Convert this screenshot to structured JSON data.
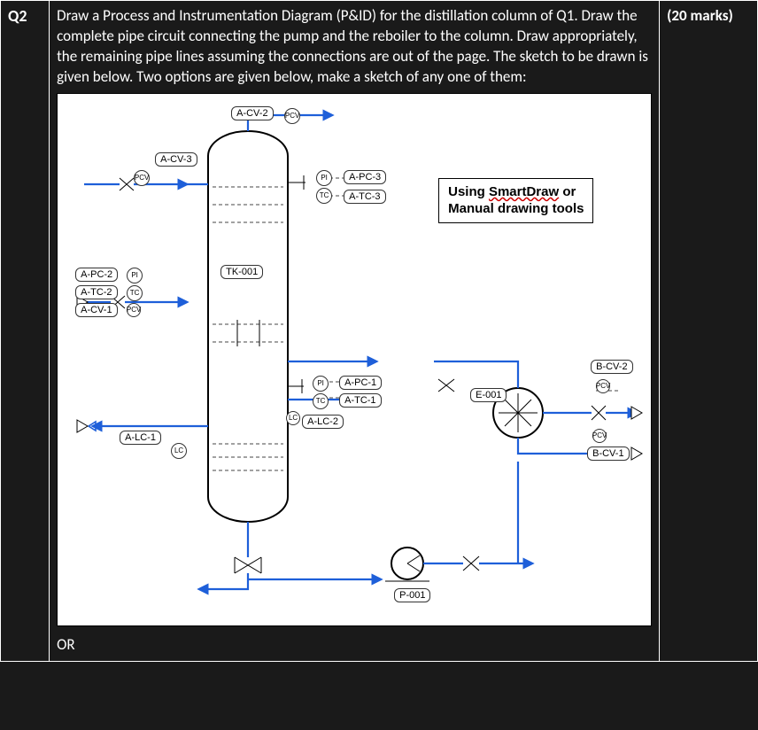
{
  "question": {
    "number": "Q2",
    "marks": "(20 marks)",
    "prompt": "Draw a Process and Instrumentation Diagram (P&ID) for the distillation column of Q1. Draw the complete pipe circuit connecting the pump and the reboiler to the column. Draw appropriately, the remaining pipe lines assuming the connections are out of the page. The sketch to be drawn is given below. Two options are given below, make a sketch of any one of them:",
    "or": "OR"
  },
  "note": {
    "line1a": "Using ",
    "line1b_wavy": "SmartDraw",
    "line1c": " or",
    "line2": "Manual drawing tools"
  },
  "tags": {
    "a_cv_2": "A-CV-2",
    "a_cv_3": "A-CV-3",
    "a_pc_3": "A-PC-3",
    "a_tc_3": "A-TC-3",
    "tk_001": "TK-001",
    "a_pc_2": "A-PC-2",
    "a_tc_2": "A-TC-2",
    "a_cv_1": "A-CV-1",
    "a_pc_1": "A-PC-1",
    "a_tc_1": "A-TC-1",
    "a_lc_2": "A-LC-2",
    "a_lc_1": "A-LC-1",
    "e_001": "E-001",
    "b_cv_2": "B-CV-2",
    "b_cv_1": "B-CV-1",
    "p_001": "P-001"
  },
  "bubbles": {
    "pcv_top": "PCV",
    "pcv_left": "PCV",
    "pi_left": "PI",
    "tc_left": "TC",
    "pcv_small": "PCV",
    "lc_left": "LC",
    "pi_r1": "PI",
    "tc_r1": "TC",
    "pi_mid": "PI",
    "tc_mid": "TC",
    "lc_mid": "LC",
    "pcv_b1": "PCV",
    "pcv_b2": "PCV"
  }
}
